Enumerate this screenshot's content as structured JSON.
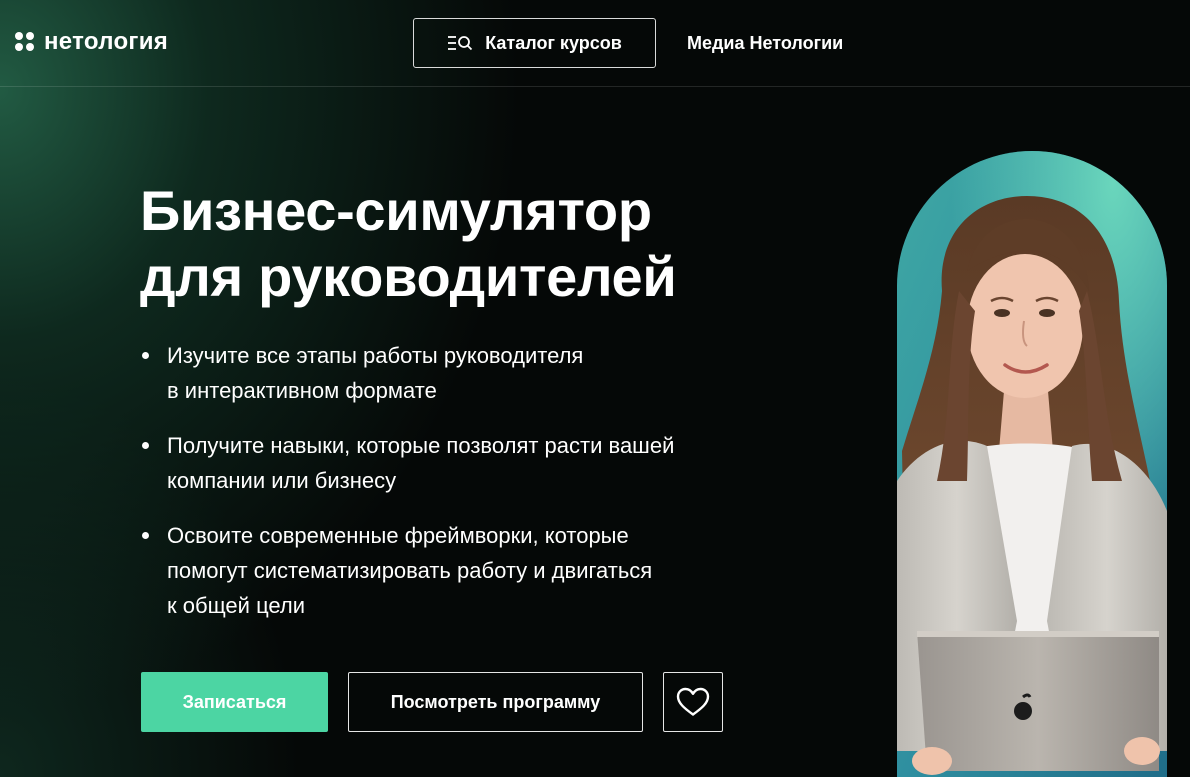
{
  "header": {
    "logo_text": "нетология",
    "catalog_label": "Каталог курсов",
    "media_label": "Медиа Нетологии"
  },
  "hero": {
    "title_line1": "Бизнес-симулятор",
    "title_line2": "для руководителей",
    "bullets": [
      {
        "line1": "Изучите все этапы работы руководителя",
        "line2": "в интерактивном формате"
      },
      {
        "line1": "Получите навыки, которые позволят расти вашей",
        "line2": "компании или бизнесу"
      },
      {
        "line1": "Освоите современные фреймворки, которые",
        "line2": "помогут систематизировать работу и двигаться",
        "line3": "к общей цели"
      }
    ],
    "enroll_label": "Записаться",
    "program_label": "Посмотреть программу"
  },
  "icons": {
    "logo": "four-dots-logo-icon",
    "catalog": "catalog-search-icon",
    "favorite": "heart-icon"
  },
  "colors": {
    "accent": "#4cd5a3",
    "background": "#050807",
    "gradient_green": "#235f46",
    "photo_teal": "#4fc4b0"
  }
}
